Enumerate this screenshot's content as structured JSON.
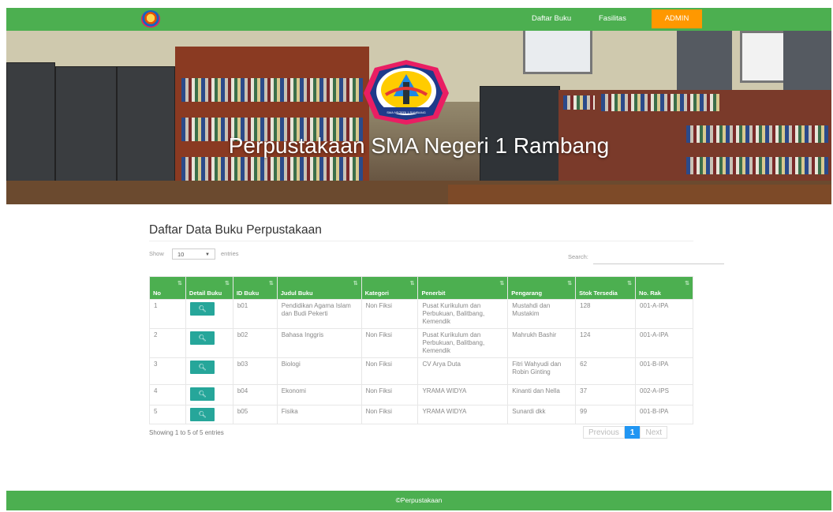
{
  "nav": {
    "links": [
      "Daftar Buku",
      "Fasilitas"
    ],
    "admin_label": "ADMIN"
  },
  "hero": {
    "title": "Perpustakaan SMA Negeri 1 Rambang",
    "logo_text": "SMA NEGERI 1 RAMBANG"
  },
  "section": {
    "title": "Daftar Data Buku Perpustakaan"
  },
  "controls": {
    "show_label": "Show",
    "entries_value": "10",
    "entries_label": "entries",
    "search_label": "Search:"
  },
  "table": {
    "headers": [
      "No",
      "Detail Buku",
      "ID Buku",
      "Judul Buku",
      "Kategori",
      "Penerbit",
      "Pengarang",
      "Stok Tersedia",
      "No. Rak"
    ],
    "rows": [
      {
        "no": "1",
        "id": "b01",
        "judul": "Pendidikan Agama Islam dan Budi Pekerti",
        "kategori": "Non Fiksi",
        "penerbit": "Pusat Kurikulum dan Perbukuan, Balitbang, Kemendik",
        "pengarang": "Mustahdi dan Mustakim",
        "stok": "128",
        "rak": "001-A-IPA"
      },
      {
        "no": "2",
        "id": "b02",
        "judul": "Bahasa Inggris",
        "kategori": "Non Fiksi",
        "penerbit": "Pusat Kurikulum dan Perbukuan, Balitbang, Kemendik",
        "pengarang": "Mahrukh Bashir",
        "stok": "124",
        "rak": "001-A-IPA"
      },
      {
        "no": "3",
        "id": "b03",
        "judul": "Biologi",
        "kategori": "Non Fiksi",
        "penerbit": "CV Arya Duta",
        "pengarang": "Fitri Wahyudi dan Robin Ginting",
        "stok": "62",
        "rak": "001-B-IPA"
      },
      {
        "no": "4",
        "id": "b04",
        "judul": "Ekonomi",
        "kategori": "Non Fiksi",
        "penerbit": "YRAMA WIDYA",
        "pengarang": "Kinanti dan Nella",
        "stok": "37",
        "rak": "002-A-IPS"
      },
      {
        "no": "5",
        "id": "b05",
        "judul": "Fisika",
        "kategori": "Non Fiksi",
        "penerbit": "YRAMA WIDYA",
        "pengarang": "Sunardi dkk",
        "stok": "99",
        "rak": "001-B-IPA"
      }
    ]
  },
  "footer_info": "Showing 1 to 5 of 5 entries",
  "pagination": {
    "previous": "Previous",
    "current": "1",
    "next": "Next"
  },
  "footer": {
    "text": "©Perpustakaan"
  },
  "colors": {
    "primary": "#4caf50",
    "admin": "#ff9800",
    "detail_button": "#26a69a",
    "page_active": "#2196f3"
  },
  "icons": {
    "detail": "search-icon",
    "sort": "sort-icon"
  }
}
